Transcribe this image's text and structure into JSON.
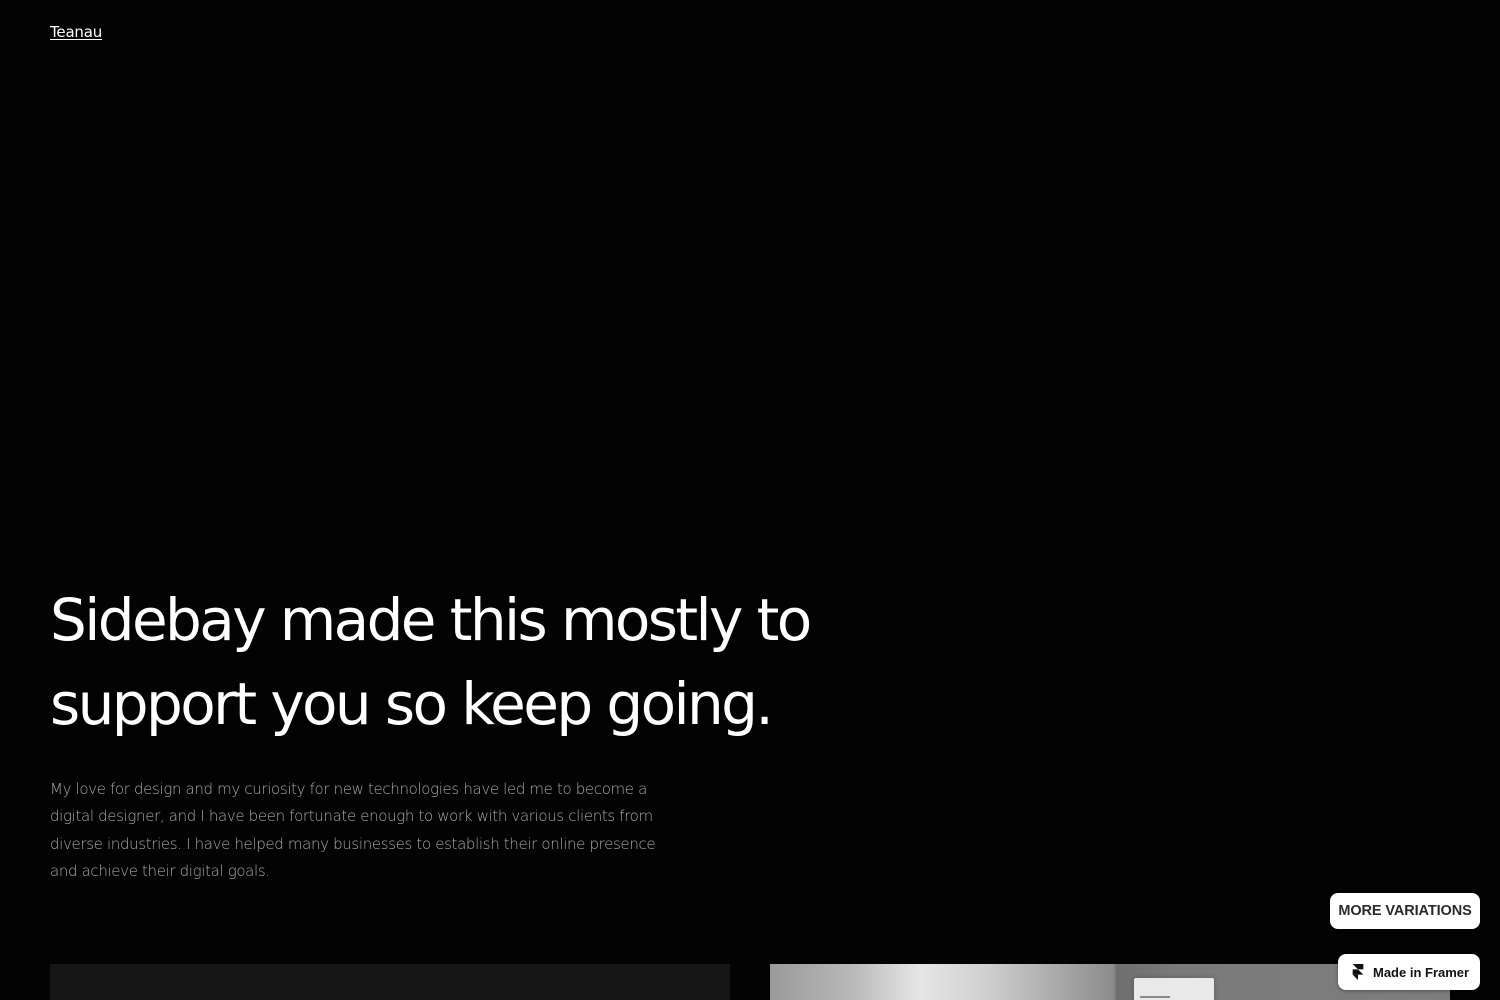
{
  "header": {
    "logo_text": "Teanau"
  },
  "hero": {
    "headline": "Sidebay made this mostly to support you so keep going.",
    "intro": "My love for design and my curiosity for new technologies have led me to become a digital designer, and I have been fortunate enough to work with various clients from diverse industries. I have helped many businesses to establish their online presence and achieve their digital goals."
  },
  "floating": {
    "more_variations_label": "MORE VARIATIONS",
    "made_in_framer_label": "Made in Framer",
    "framer_icon": "framer-logo-icon"
  },
  "colors": {
    "background": "#030303",
    "headline": "#ffffff",
    "body_text": "#a8a8a8",
    "card_dark": "#161616",
    "badge_background": "#ffffff"
  }
}
